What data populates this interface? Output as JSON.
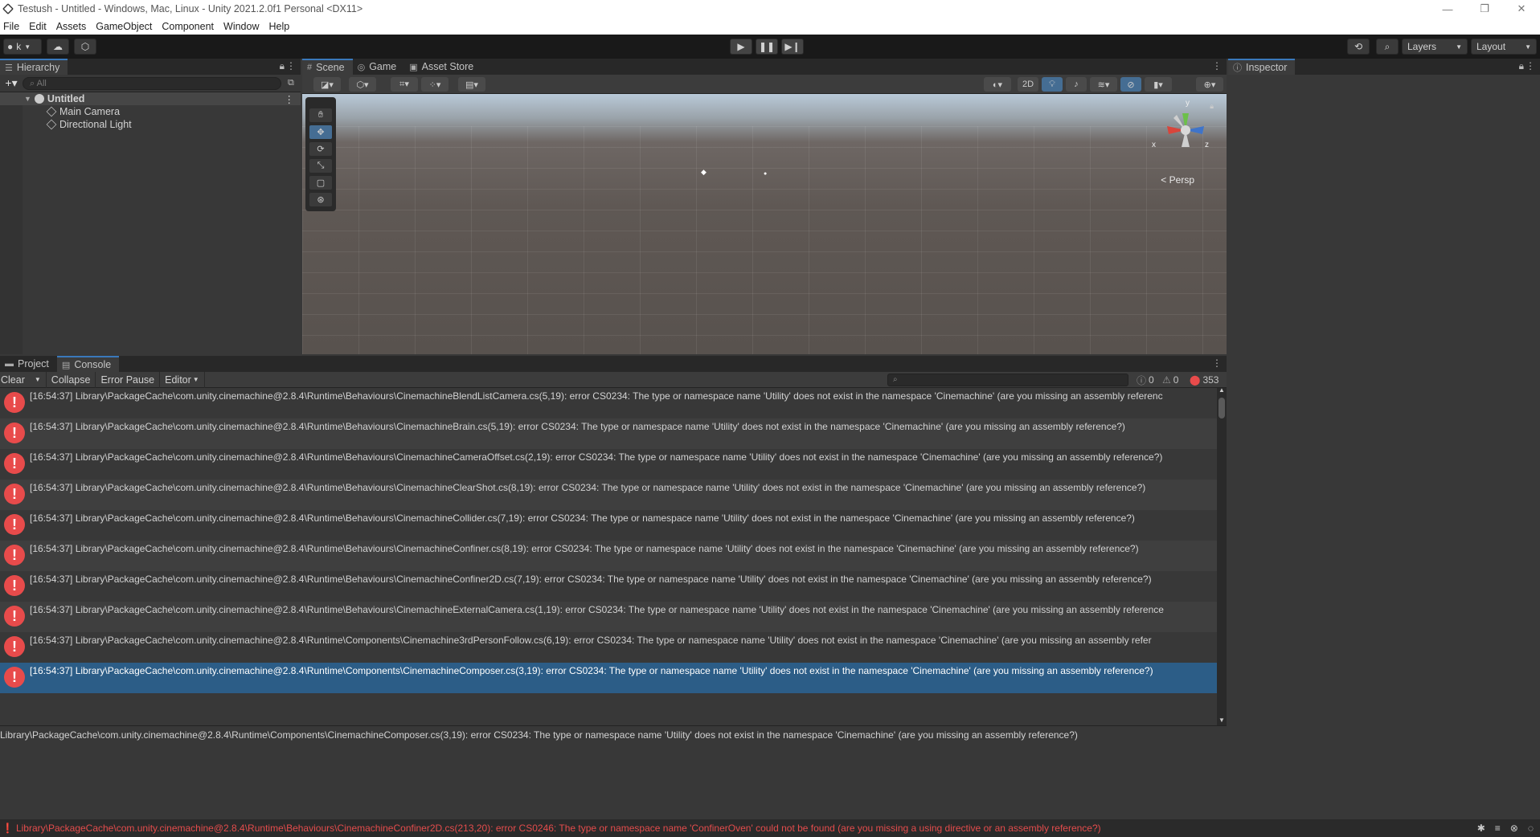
{
  "window": {
    "title": "Testush - Untitled - Windows, Mac, Linux - Unity 2021.2.0f1 Personal <DX11>",
    "controls": {
      "minimize": "—",
      "restore": "❐",
      "close": "✕"
    }
  },
  "menubar": [
    "File",
    "Edit",
    "Assets",
    "GameObject",
    "Component",
    "Window",
    "Help"
  ],
  "toolbar": {
    "account": "k",
    "layers": "Layers",
    "layout": "Layout"
  },
  "hierarchy": {
    "tab": "Hierarchy",
    "search_placeholder": "All",
    "scene": "Untitled",
    "items": [
      "Main Camera",
      "Directional Light"
    ]
  },
  "scene_view": {
    "tabs": [
      "Scene",
      "Game",
      "Asset Store"
    ],
    "mode_2d": "2D",
    "persp": "Persp",
    "gizmo_axes": [
      "y",
      "x",
      "z"
    ]
  },
  "inspector": {
    "tab": "Inspector"
  },
  "console": {
    "tabs": [
      "Project",
      "Console"
    ],
    "tools": [
      "Clear",
      "Collapse",
      "Error Pause",
      "Editor"
    ],
    "counts": {
      "info": "0",
      "warning": "0",
      "error": "353"
    },
    "logs": [
      "[16:54:37] Library\\PackageCache\\com.unity.cinemachine@2.8.4\\Runtime\\Behaviours\\CinemachineBlendListCamera.cs(5,19): error CS0234: The type or namespace name 'Utility' does not exist in the namespace 'Cinemachine' (are you missing an assembly referenc",
      "[16:54:37] Library\\PackageCache\\com.unity.cinemachine@2.8.4\\Runtime\\Behaviours\\CinemachineBrain.cs(5,19): error CS0234: The type or namespace name 'Utility' does not exist in the namespace 'Cinemachine' (are you missing an assembly reference?)",
      "[16:54:37] Library\\PackageCache\\com.unity.cinemachine@2.8.4\\Runtime\\Behaviours\\CinemachineCameraOffset.cs(2,19): error CS0234: The type or namespace name 'Utility' does not exist in the namespace 'Cinemachine' (are you missing an assembly reference?)",
      "[16:54:37] Library\\PackageCache\\com.unity.cinemachine@2.8.4\\Runtime\\Behaviours\\CinemachineClearShot.cs(8,19): error CS0234: The type or namespace name 'Utility' does not exist in the namespace 'Cinemachine' (are you missing an assembly reference?)",
      "[16:54:37] Library\\PackageCache\\com.unity.cinemachine@2.8.4\\Runtime\\Behaviours\\CinemachineCollider.cs(7,19): error CS0234: The type or namespace name 'Utility' does not exist in the namespace 'Cinemachine' (are you missing an assembly reference?)",
      "[16:54:37] Library\\PackageCache\\com.unity.cinemachine@2.8.4\\Runtime\\Behaviours\\CinemachineConfiner.cs(8,19): error CS0234: The type or namespace name 'Utility' does not exist in the namespace 'Cinemachine' (are you missing an assembly reference?)",
      "[16:54:37] Library\\PackageCache\\com.unity.cinemachine@2.8.4\\Runtime\\Behaviours\\CinemachineConfiner2D.cs(7,19): error CS0234: The type or namespace name 'Utility' does not exist in the namespace 'Cinemachine' (are you missing an assembly reference?)",
      "[16:54:37] Library\\PackageCache\\com.unity.cinemachine@2.8.4\\Runtime\\Behaviours\\CinemachineExternalCamera.cs(1,19): error CS0234: The type or namespace name 'Utility' does not exist in the namespace 'Cinemachine' (are you missing an assembly reference",
      "[16:54:37] Library\\PackageCache\\com.unity.cinemachine@2.8.4\\Runtime\\Components\\Cinemachine3rdPersonFollow.cs(6,19): error CS0234: The type or namespace name 'Utility' does not exist in the namespace 'Cinemachine' (are you missing an assembly refer",
      "[16:54:37] Library\\PackageCache\\com.unity.cinemachine@2.8.4\\Runtime\\Components\\CinemachineComposer.cs(3,19): error CS0234: The type or namespace name 'Utility' does not exist in the namespace 'Cinemachine' (are you missing an assembly reference?)"
    ],
    "selected_index": 9,
    "detail": "Library\\PackageCache\\com.unity.cinemachine@2.8.4\\Runtime\\Components\\CinemachineComposer.cs(3,19): error CS0234: The type or namespace name 'Utility' does not exist in the namespace 'Cinemachine' (are you missing an assembly reference?)"
  },
  "statusbar": {
    "message": "Library\\PackageCache\\com.unity.cinemachine@2.8.4\\Runtime\\Behaviours\\CinemachineConfiner2D.cs(213,20): error CS0246: The type or namespace name 'ConfinerOven' could not be found (are you missing a using directive or an assembly reference?)"
  },
  "colors": {
    "accent": "#3a79bb",
    "error": "#e84b4b",
    "selection": "#2c5d87"
  }
}
